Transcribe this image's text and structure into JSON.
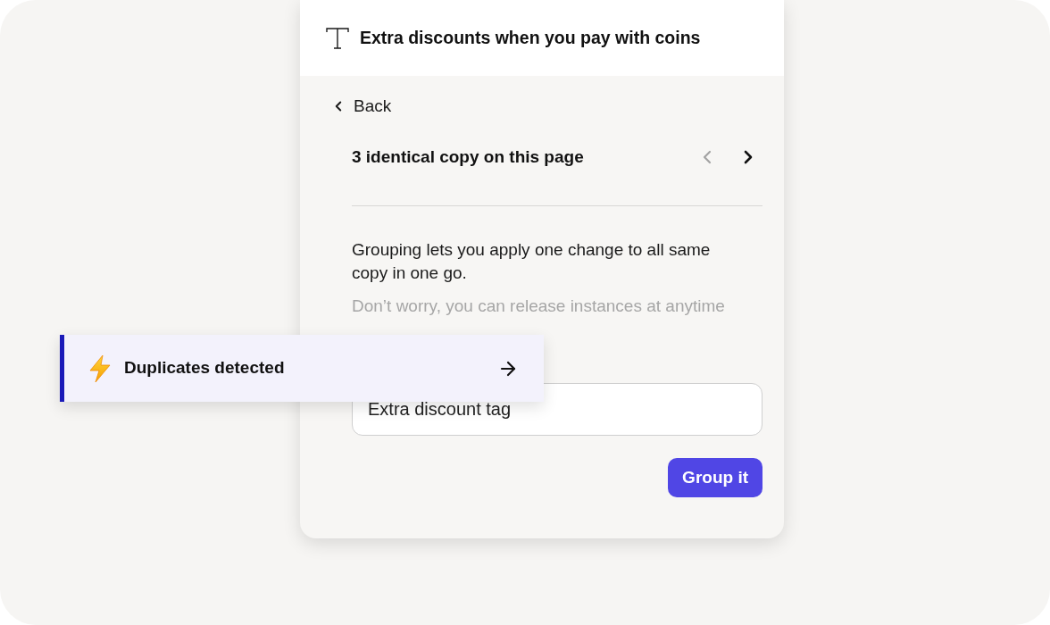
{
  "panel": {
    "header": {
      "title": "Extra discounts when you pay with coins"
    },
    "back_link": {
      "label": "Back"
    },
    "pager": {
      "title": "3 identical copy on this page",
      "prev": {
        "disabled": true
      },
      "next": {
        "disabled": false
      }
    },
    "description": "Grouping lets you apply one change to all same copy in one go.",
    "note": "Don’t worry, you can release instances at anytime",
    "name_field": {
      "value": "Extra discount tag"
    },
    "buttons": [
      {
        "label": "Group it",
        "kind": "primary"
      }
    ]
  },
  "toast": {
    "title": "Duplicates detected"
  }
}
